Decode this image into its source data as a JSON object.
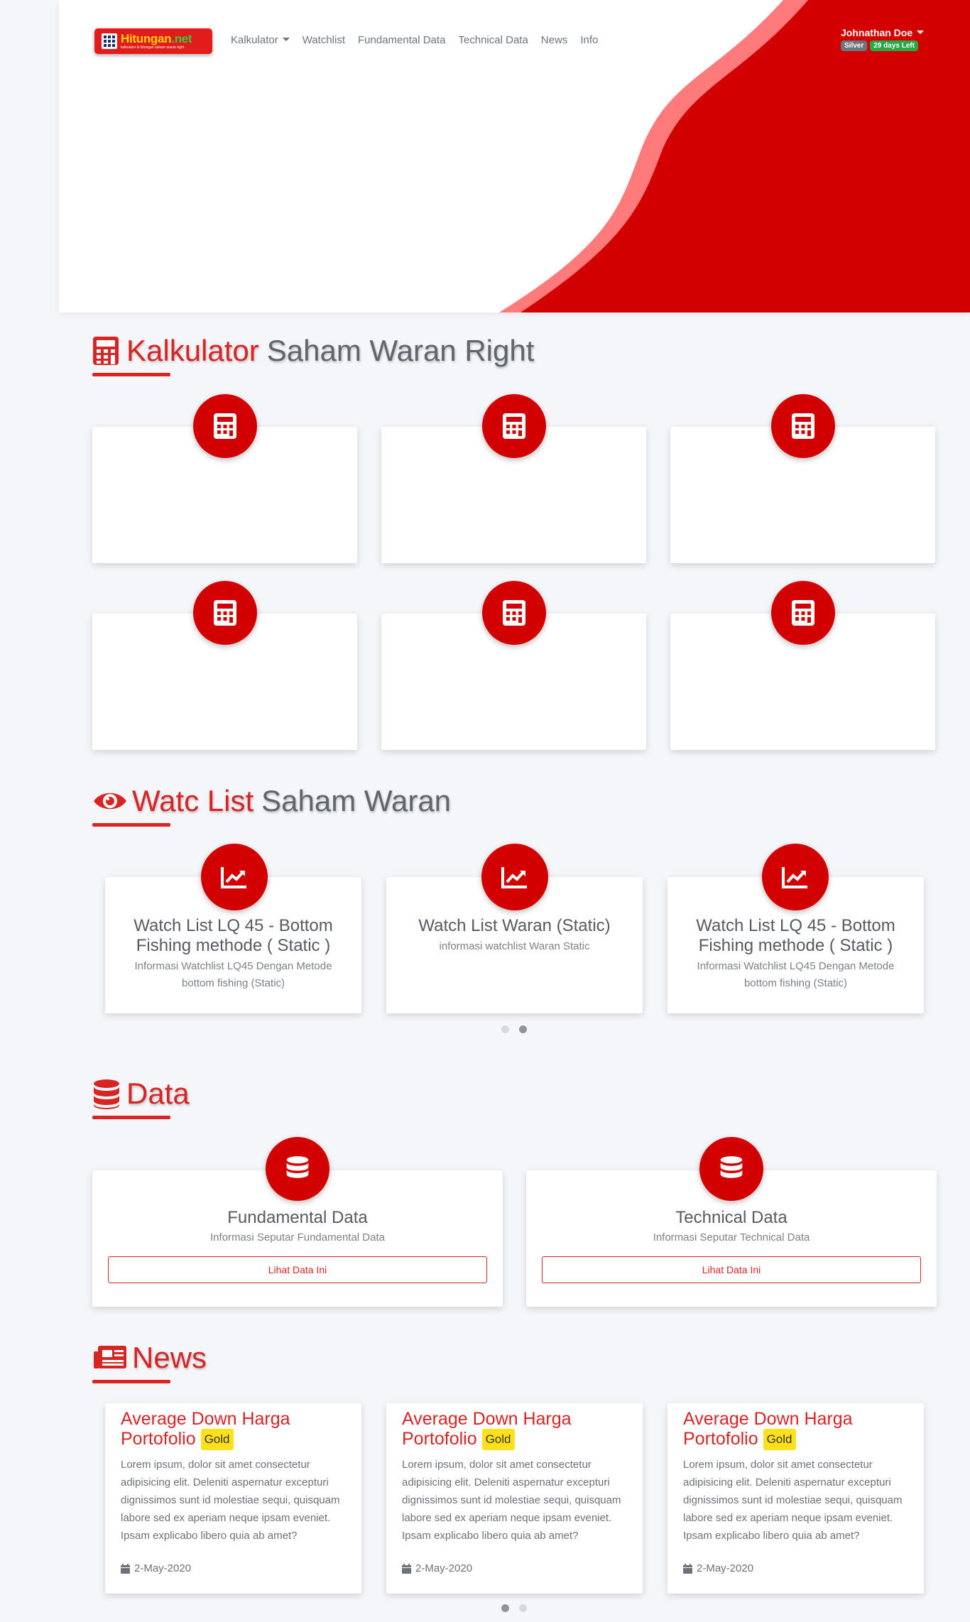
{
  "brand": {
    "name": "Hitungan",
    "suffix": ".net",
    "tagline": "kalkulator & hitungan saham waran right"
  },
  "nav": {
    "items": [
      {
        "label": "Kalkulator",
        "dropdown": true
      },
      {
        "label": "Watchlist"
      },
      {
        "label": "Fundamental Data"
      },
      {
        "label": "Technical Data"
      },
      {
        "label": "News"
      },
      {
        "label": "Info"
      }
    ]
  },
  "user": {
    "name": "Johnathan Doe",
    "tier": "Silver",
    "days_left": "29 days Left"
  },
  "kalkulator": {
    "title_red": "Kalkulator",
    "title_gray": "Saham Waran Right"
  },
  "watchlist": {
    "title_red": "Watc List",
    "title_gray": "Saham Waran",
    "cards": [
      {
        "title": "Watch List LQ 45 - Bottom Fishing methode ( Static )",
        "desc": "Informasi Watchlist LQ45 Dengan Metode bottom fishing (Static)"
      },
      {
        "title": "Watch List Waran (Static)",
        "desc": "informasi watchlist Waran Static"
      },
      {
        "title": "Watch List LQ 45 - Bottom Fishing methode ( Static )",
        "desc": "Informasi Watchlist LQ45 Dengan Metode bottom fishing (Static)"
      }
    ]
  },
  "data_section": {
    "title_red": "Data",
    "cards": [
      {
        "title": "Fundamental Data",
        "desc": "Informasi Seputar Fundamental Data",
        "button": "Lihat Data Ini"
      },
      {
        "title": "Technical Data",
        "desc": "Informasi Seputar Technical Data",
        "button": "Lihat Data Ini"
      }
    ]
  },
  "news": {
    "title_red": "News",
    "cards": [
      {
        "title": "Average Down Harga Portofolio",
        "badge": "Gold",
        "body": "Lorem ipsum, dolor sit amet consectetur adipisicing elit. Deleniti aspernatur excepturi dignissimos sunt id molestiae sequi, quisquam labore sed ex aperiam neque ipsam eveniet. Ipsam explicabo libero quia ab amet?",
        "date": "2-May-2020"
      },
      {
        "title": "Average Down Harga Portofolio",
        "badge": "Gold",
        "body": "Lorem ipsum, dolor sit amet consectetur adipisicing elit. Deleniti aspernatur excepturi dignissimos sunt id molestiae sequi, quisquam labore sed ex aperiam neque ipsam eveniet. Ipsam explicabo libero quia ab amet?",
        "date": "2-May-2020"
      },
      {
        "title": "Average Down Harga Portofolio",
        "badge": "Gold",
        "body": "Lorem ipsum, dolor sit amet consectetur adipisicing elit. Deleniti aspernatur excepturi dignissimos sunt id molestiae sequi, quisquam labore sed ex aperiam neque ipsam eveniet. Ipsam explicabo libero quia ab amet?",
        "date": "2-May-2020"
      }
    ]
  },
  "colors": {
    "primary": "#d20000",
    "accent_red": "#d92424",
    "wave_light": "#ff7b7b",
    "background": "#f5f6fa"
  }
}
